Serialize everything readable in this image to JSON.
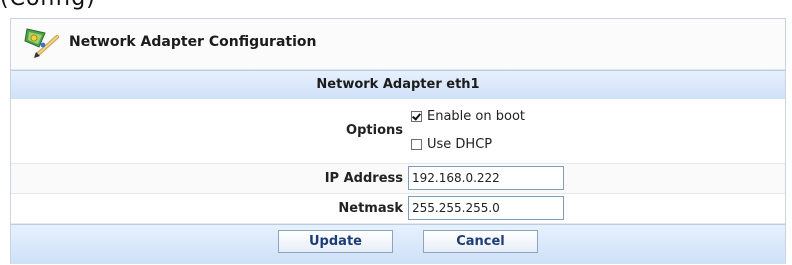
{
  "page": {
    "top_cut_text": "(Config)"
  },
  "header": {
    "title": "Network Adapter Configuration",
    "icon": "network-pencil-icon"
  },
  "section": {
    "title": "Network Adapter eth1"
  },
  "form": {
    "options_label": "Options",
    "enable_on_boot_label": "Enable on boot",
    "enable_on_boot_checked": true,
    "use_dhcp_label": "Use DHCP",
    "use_dhcp_checked": false,
    "ip_address_label": "IP Address",
    "ip_address_value": "192.168.0.222",
    "netmask_label": "Netmask",
    "netmask_value": "255.255.255.0"
  },
  "actions": {
    "update_label": "Update",
    "cancel_label": "Cancel"
  },
  "colors": {
    "bar_gradient_top": "#e7f1fd",
    "bar_gradient_bottom": "#cfe0f7",
    "button_text": "#1d3c78",
    "input_border": "#7f9db9"
  }
}
